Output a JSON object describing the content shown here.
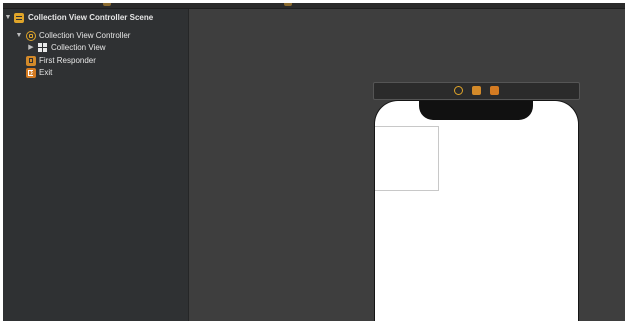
{
  "outline": {
    "items": [
      {
        "label": "Collection View Controller Scene",
        "icon": "scene-icon"
      },
      {
        "label": "Collection View Controller",
        "icon": "view-controller-icon"
      },
      {
        "label": "Collection View",
        "icon": "collection-view-grid-icon"
      },
      {
        "label": "First Responder",
        "icon": "first-responder-cube-icon"
      },
      {
        "label": "Exit",
        "icon": "exit-icon"
      }
    ]
  },
  "scene_bar": {
    "icons": [
      "view-controller-icon",
      "first-responder-cube-icon",
      "exit-icon"
    ]
  },
  "colors": {
    "accent": "#e0a52a",
    "outline_bg": "#2f3133",
    "canvas_bg": "#3e3e3e",
    "device_bg": "#ffffff"
  }
}
